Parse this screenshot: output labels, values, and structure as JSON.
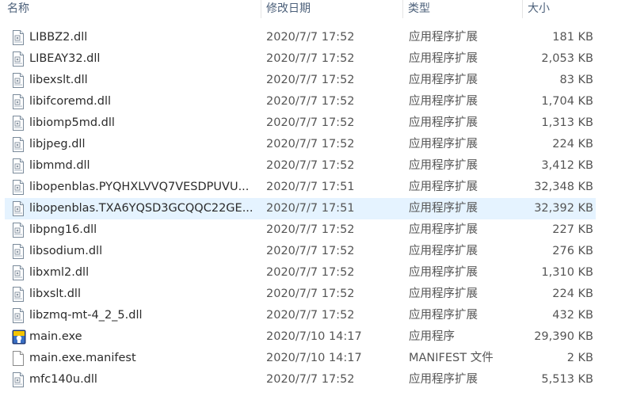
{
  "header": {
    "name": "名称",
    "date": "修改日期",
    "type": "类型",
    "size": "大小"
  },
  "files": [
    {
      "name": "LIBBZ2.dll",
      "date": "2020/7/7 17:52",
      "type": "应用程序扩展",
      "size": "181 KB",
      "icon": "dll-file-icon"
    },
    {
      "name": "LIBEAY32.dll",
      "date": "2020/7/7 17:52",
      "type": "应用程序扩展",
      "size": "2,053 KB",
      "icon": "dll-file-icon"
    },
    {
      "name": "libexslt.dll",
      "date": "2020/7/7 17:52",
      "type": "应用程序扩展",
      "size": "83 KB",
      "icon": "dll-file-icon"
    },
    {
      "name": "libifcoremd.dll",
      "date": "2020/7/7 17:52",
      "type": "应用程序扩展",
      "size": "1,704 KB",
      "icon": "dll-file-icon"
    },
    {
      "name": "libiomp5md.dll",
      "date": "2020/7/7 17:52",
      "type": "应用程序扩展",
      "size": "1,313 KB",
      "icon": "dll-file-icon"
    },
    {
      "name": "libjpeg.dll",
      "date": "2020/7/7 17:52",
      "type": "应用程序扩展",
      "size": "224 KB",
      "icon": "dll-file-icon"
    },
    {
      "name": "libmmd.dll",
      "date": "2020/7/7 17:52",
      "type": "应用程序扩展",
      "size": "3,412 KB",
      "icon": "dll-file-icon"
    },
    {
      "name": "libopenblas.PYQHXLVVQ7VESDPUVU...",
      "date": "2020/7/7 17:51",
      "type": "应用程序扩展",
      "size": "32,348 KB",
      "icon": "dll-file-icon"
    },
    {
      "name": "libopenblas.TXA6YQSD3GCQQC22GE...",
      "date": "2020/7/7 17:51",
      "type": "应用程序扩展",
      "size": "32,392 KB",
      "icon": "dll-file-icon",
      "selected": true
    },
    {
      "name": "libpng16.dll",
      "date": "2020/7/7 17:52",
      "type": "应用程序扩展",
      "size": "227 KB",
      "icon": "dll-file-icon"
    },
    {
      "name": "libsodium.dll",
      "date": "2020/7/7 17:52",
      "type": "应用程序扩展",
      "size": "276 KB",
      "icon": "dll-file-icon"
    },
    {
      "name": "libxml2.dll",
      "date": "2020/7/7 17:52",
      "type": "应用程序扩展",
      "size": "1,310 KB",
      "icon": "dll-file-icon"
    },
    {
      "name": "libxslt.dll",
      "date": "2020/7/7 17:52",
      "type": "应用程序扩展",
      "size": "224 KB",
      "icon": "dll-file-icon"
    },
    {
      "name": "libzmq-mt-4_2_5.dll",
      "date": "2020/7/7 17:52",
      "type": "应用程序扩展",
      "size": "432 KB",
      "icon": "dll-file-icon"
    },
    {
      "name": "main.exe",
      "date": "2020/7/10 14:17",
      "type": "应用程序",
      "size": "29,390 KB",
      "icon": "exe-app-icon"
    },
    {
      "name": "main.exe.manifest",
      "date": "2020/7/10 14:17",
      "type": "MANIFEST 文件",
      "size": "2 KB",
      "icon": "blank-file-icon"
    },
    {
      "name": "mfc140u.dll",
      "date": "2020/7/7 17:52",
      "type": "应用程序扩展",
      "size": "5,513 KB",
      "icon": "dll-file-icon"
    }
  ]
}
